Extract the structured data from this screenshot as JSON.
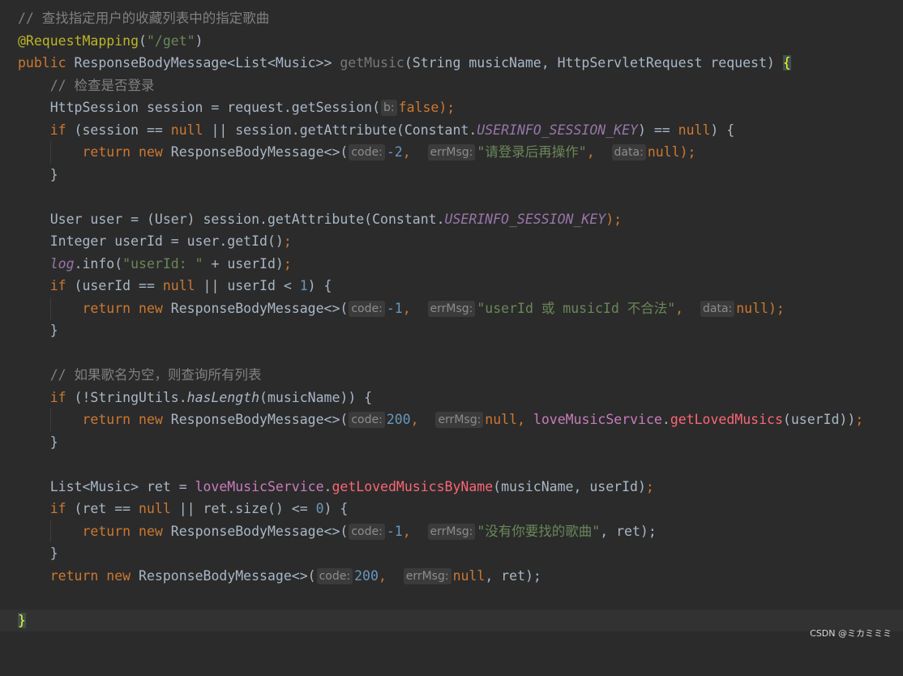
{
  "editor": {
    "line1": {
      "comment": "// 查找指定用户的收藏列表中的指定歌曲"
    },
    "line2": {
      "annotation": "@RequestMapping",
      "paren_open": "(",
      "path": "\"/get\"",
      "paren_close": ")"
    },
    "line3": {
      "kw_public": "public",
      "ret_type": " ResponseBodyMessage<List<Music>> ",
      "method": "getMusic",
      "params": "(String musicName, HttpServletRequest request) ",
      "brace": "{"
    },
    "line4": {
      "comment": "// 检查是否登录"
    },
    "line5": {
      "pre": "HttpSession session = request.getSession(",
      "hint_b": "b:",
      "val": "false",
      "post": ");"
    },
    "line6": {
      "kw_if": "if",
      "a": " (session == ",
      "kw_null": "null",
      "b": " || session.getAttribute(Constant.",
      "const": "USERINFO_SESSION_KEY",
      "c": ") == ",
      "kw_null2": "null",
      "d": ") {"
    },
    "line7": {
      "kw_return": "return",
      "kw_new": "new",
      "cls": " ResponseBodyMessage<>(",
      "hint_code": "code:",
      "code": "-2",
      "comma1": ",",
      "hint_err": "errMsg:",
      "msg": "\"请登录后再操作\"",
      "comma2": ",",
      "hint_data": "data:",
      "null": "null",
      "end": ");"
    },
    "line8": {
      "text": "}"
    },
    "line10": {
      "a": "User user = (User) session.getAttribute(Constant.",
      "const": "USERINFO_SESSION_KEY",
      "end": ");"
    },
    "line11": {
      "a": "Integer userId = user.getId()",
      "end": ";"
    },
    "line12": {
      "log": "log",
      "a": ".info(",
      "str": "\"userId: \"",
      "b": " + userId)",
      "end": ";"
    },
    "line13": {
      "kw_if": "if",
      "a": " (userId == ",
      "kw_null": "null",
      "b": " || userId < ",
      "num": "1",
      "c": ") {"
    },
    "line14": {
      "kw_return": "return",
      "kw_new": "new",
      "cls": " ResponseBodyMessage<>(",
      "hint_code": "code:",
      "code": "-1",
      "comma1": ",",
      "hint_err": "errMsg:",
      "msg": "\"userId 或 musicId 不合法\"",
      "comma2": ",",
      "hint_data": "data:",
      "null": "null",
      "end": ");"
    },
    "line15": {
      "text": "}"
    },
    "line17": {
      "comment": "// 如果歌名为空，则查询所有列表"
    },
    "line18": {
      "kw_if": "if",
      "a": " (!StringUtils.",
      "static": "hasLength",
      "b": "(musicName)) {"
    },
    "line19": {
      "kw_return": "return",
      "kw_new": "new",
      "cls": " ResponseBodyMessage<>(",
      "hint_code": "code:",
      "code": "200",
      "comma1": ",",
      "hint_err": "errMsg:",
      "null": "null",
      "comma2": ", ",
      "service": "loveMusicService",
      "dot": ".",
      "meth": "getLovedMusics",
      "args": "(userId))",
      "end": ";"
    },
    "line20": {
      "text": "}"
    },
    "line22": {
      "a": "List<Music> ret = ",
      "service": "loveMusicService",
      "dot": ".",
      "meth": "getLovedMusicsByName",
      "args": "(musicName, userId)",
      "end": ";"
    },
    "line23": {
      "kw_if": "if",
      "a": " (ret == ",
      "kw_null": "null",
      "b": " || ret.size() <= ",
      "num": "0",
      "c": ") {"
    },
    "line24": {
      "kw_return": "return",
      "kw_new": "new",
      "cls": " ResponseBodyMessage<>(",
      "hint_code": "code:",
      "code": "-1",
      "comma1": ",",
      "hint_err": "errMsg:",
      "msg": "\"没有你要找的歌曲\"",
      "end": ", ret);"
    },
    "line25": {
      "text": "}"
    },
    "line26": {
      "kw_return": "return",
      "kw_new": "new",
      "cls": " ResponseBodyMessage<>(",
      "hint_code": "code:",
      "code": "200",
      "comma1": ",",
      "hint_err": "errMsg:",
      "null": "null",
      "end": ", ret);"
    },
    "line28": {
      "brace": "}"
    }
  },
  "watermark": "CSDN @ミカミミミ",
  "colors": {
    "background": "#2b2b2b",
    "keyword": "#cc7832",
    "string": "#6a8759",
    "number": "#6897bb",
    "comment": "#808080",
    "annotation": "#bbb529",
    "constant": "#9876aa",
    "method_decl": "#ffc66d"
  }
}
